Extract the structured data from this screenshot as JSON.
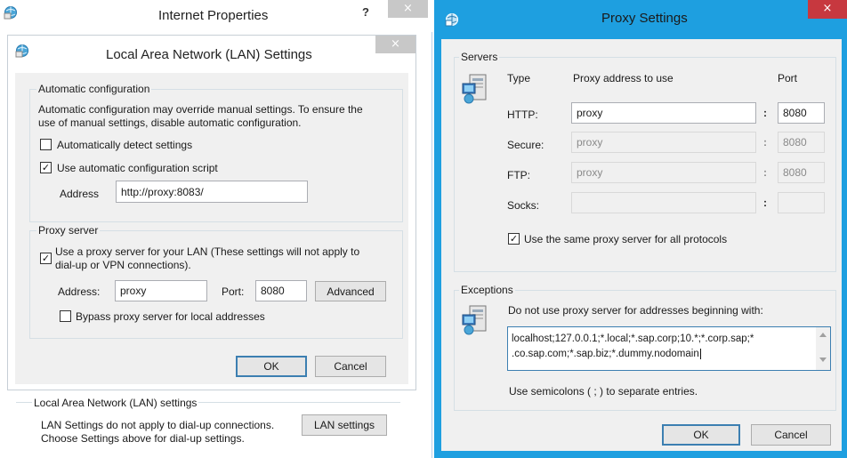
{
  "internet_properties": {
    "title": "Internet Properties",
    "help": "?",
    "close": "×",
    "lan_group_label": "Local Area Network (LAN) settings",
    "lan_desc_line1": "LAN Settings do not apply to dial-up connections.",
    "lan_desc_line2": "Choose Settings above for dial-up settings.",
    "lan_settings_button": "LAN settings"
  },
  "lan_dialog": {
    "title": "Local Area Network (LAN) Settings",
    "close": "×",
    "auto_config": {
      "legend": "Automatic configuration",
      "desc_line1": "Automatic configuration may override manual settings.  To ensure the",
      "desc_line2": "use of manual settings, disable automatic configuration.",
      "auto_detect_label": "Automatically detect settings",
      "auto_detect_checked": "",
      "use_script_label": "Use automatic configuration script",
      "use_script_checked": "✓",
      "address_label": "Address",
      "address_value": "http://proxy:8083/"
    },
    "proxy_server": {
      "legend": "Proxy server",
      "use_proxy_line1": "Use a proxy server for your LAN (These settings will not apply to",
      "use_proxy_line2": "dial-up or VPN connections).",
      "use_proxy_checked": "✓",
      "address_label": "Address:",
      "address_value": "proxy",
      "port_label": "Port:",
      "port_value": "8080",
      "advanced_button": "Advanced",
      "bypass_label": "Bypass proxy server for local addresses",
      "bypass_checked": ""
    },
    "ok_button": "OK",
    "cancel_button": "Cancel"
  },
  "proxy_settings": {
    "title": "Proxy Settings",
    "close": "×",
    "servers_legend": "Servers",
    "col_type": "Type",
    "col_address": "Proxy address to use",
    "col_port": "Port",
    "colon": ":",
    "rows": [
      {
        "type": "HTTP:",
        "address": "proxy",
        "port": "8080"
      },
      {
        "type": "Secure:",
        "address": "proxy",
        "port": "8080"
      },
      {
        "type": "FTP:",
        "address": "proxy",
        "port": "8080"
      },
      {
        "type": "Socks:",
        "address": "",
        "port": ""
      }
    ],
    "same_proxy_label": "Use the same proxy server for all protocols",
    "same_proxy_checked": "✓",
    "exceptions_legend": "Exceptions",
    "exceptions_desc": "Do not use proxy server for addresses beginning with:",
    "exceptions_line1": "localhost;127.0.0.1;*.local;*.sap.corp;10.*;*.corp.sap;*",
    "exceptions_line2": ".co.sap.com;*.sap.biz;*.dummy.nodomain",
    "semicolon_note": "Use semicolons ( ; ) to separate entries.",
    "ok_button": "OK",
    "cancel_button": "Cancel"
  },
  "colors": {
    "title_bar": "#ffffff",
    "frame_blue": "#1e9fe0",
    "close_red": "#c7383f",
    "close_inactive": "#c8c8c8",
    "dialog_bg": "#f0f0f0"
  }
}
